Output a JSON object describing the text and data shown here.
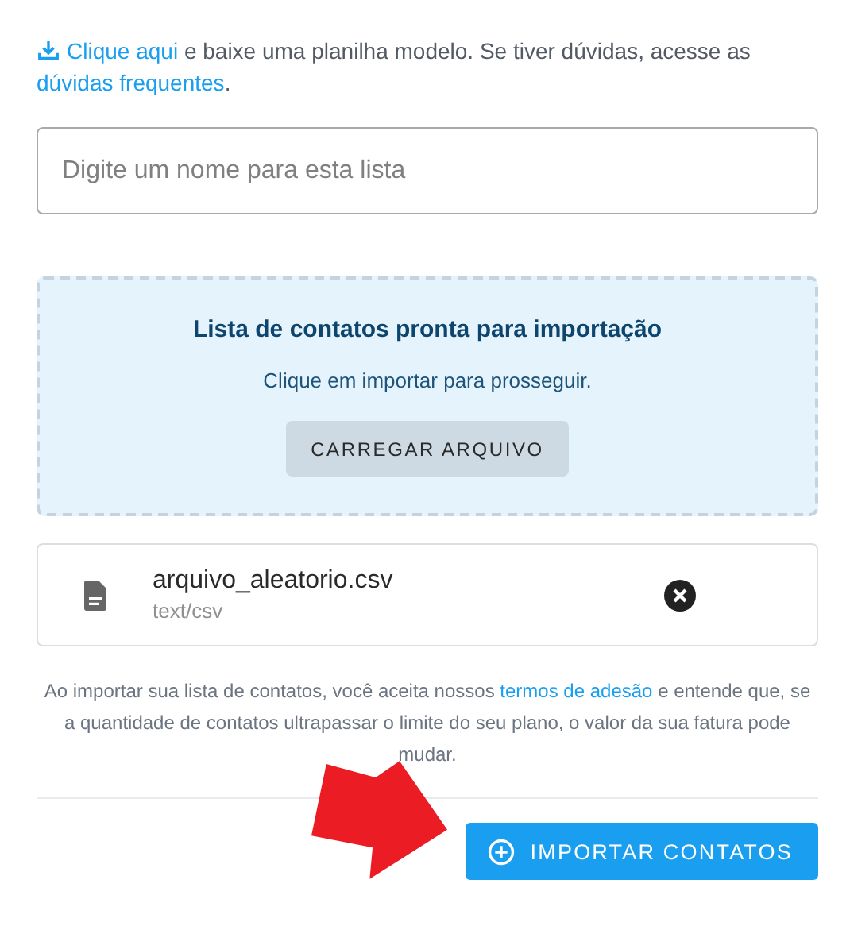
{
  "intro": {
    "link": "Clique aqui",
    "text": "e baixe uma planilha modelo. Se tiver dúvidas, acesse as",
    "faq_link": "dúvidas frequentes",
    "end": "."
  },
  "name_field": {
    "placeholder": "Digite um nome para esta lista"
  },
  "dropzone": {
    "title": "Lista de contatos pronta para importação",
    "subtitle": "Clique em importar para prosseguir.",
    "button": "CARREGAR ARQUIVO"
  },
  "file": {
    "name": "arquivo_aleatorio.csv",
    "type": "text/csv"
  },
  "terms": {
    "before": "Ao importar sua lista de contatos, você aceita nossos",
    "link": "termos de adesão",
    "after": "e entende que, se a quantidade de contatos ultrapassar o limite do seu plano, o valor da sua fatura pode mudar."
  },
  "import_button": "IMPORTAR CONTATOS"
}
